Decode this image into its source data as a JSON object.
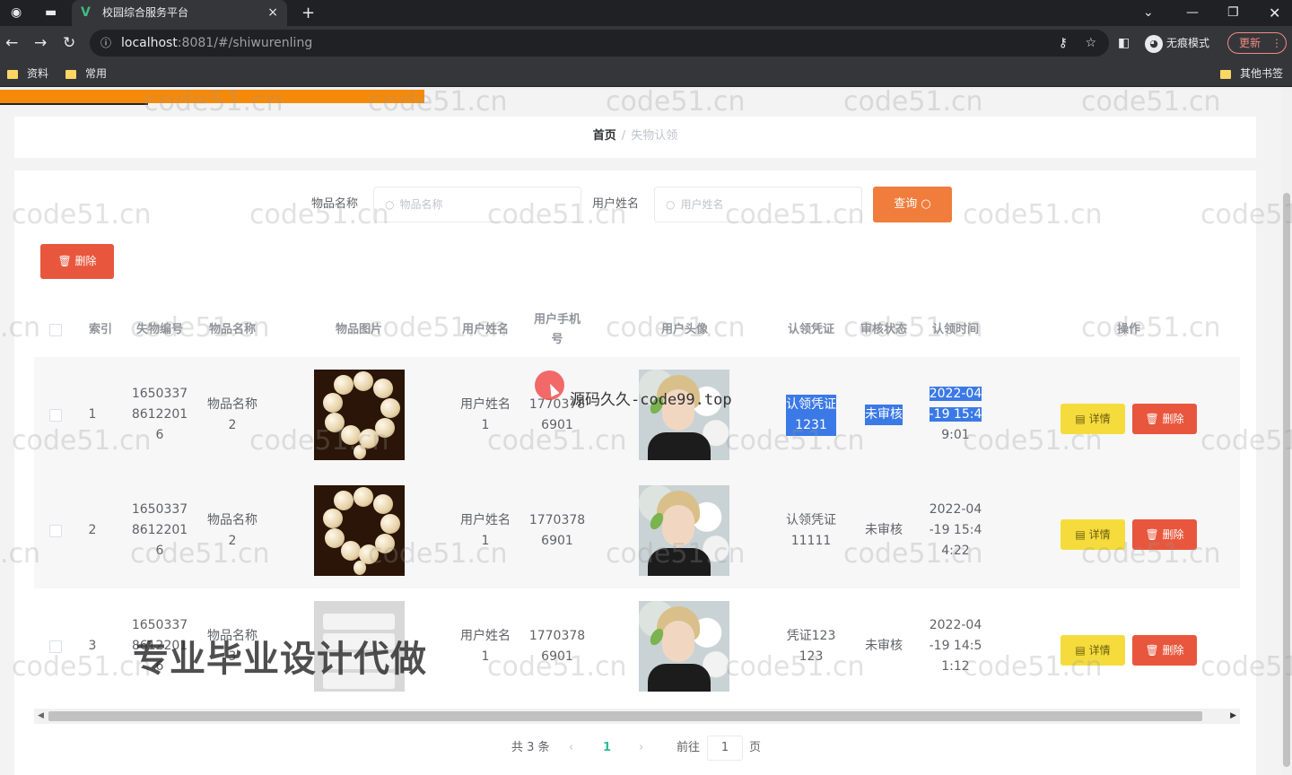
{
  "browser": {
    "tab_title": "校园综合服务平台",
    "tab_close": "×",
    "new_tab": "+",
    "url_host": "localhost",
    "url_path": ":8081/#/shiwurenling",
    "incognito_label": "无痕模式",
    "update_label": "更新",
    "bookmarks": [
      "资料",
      "常用"
    ],
    "other_bookmarks": "其他书签"
  },
  "breadcrumb": {
    "home": "首页",
    "separator": "/",
    "current": "失物认领"
  },
  "search": {
    "item_name_label": "物品名称",
    "item_name_placeholder": "物品名称",
    "user_name_label": "用户姓名",
    "user_name_placeholder": "用户姓名",
    "query_label": "查询"
  },
  "toolbar": {
    "delete_label": "删除"
  },
  "table": {
    "headers": [
      "索引",
      "失物编号",
      "物品名称",
      "物品图片",
      "用户姓名",
      "用户手机号",
      "用户头像",
      "认领凭证",
      "审核状态",
      "认领时间",
      "操作"
    ],
    "rows": [
      {
        "index": "1",
        "lost_no": "16503378612201\n6",
        "item_name": "物品名称\n2",
        "image": "beads",
        "user_name": "用户姓名\n1",
        "phone": "1770378\n6901",
        "voucher": "认领凭证\n1231",
        "status": "未审核",
        "time": "2022-04\n-19 15:4\n9:01"
      },
      {
        "index": "2",
        "lost_no": "16503378612201\n6",
        "item_name": "物品名称\n2",
        "image": "beads",
        "user_name": "用户姓名\n1",
        "phone": "1770378\n6901",
        "voucher": "认领凭证\n11111",
        "status": "未审核",
        "time": "2022-04\n-19 15:4\n4:22"
      },
      {
        "index": "3",
        "lost_no": "16503378612201\n6",
        "item_name": "物品名称\n3",
        "image": "towel",
        "user_name": "用户姓名\n1",
        "phone": "1770378\n6901",
        "voucher": "凭证123\n123",
        "status": "未审核",
        "time": "2022-04\n-19 14:5\n1:12"
      }
    ],
    "detail_label": "详情",
    "delete_label": "删除"
  },
  "pagination": {
    "total": "共 3 条",
    "current_page": "1",
    "goto_prefix": "前往",
    "goto_value": "1",
    "goto_suffix": "页"
  },
  "overlays": {
    "watermark": "code51.cn",
    "watermark_short": ".cn",
    "source_text": "源码久久-code99.top",
    "promo_text": "专业毕业设计代做"
  },
  "colors": {
    "accent": "#f07d3c",
    "danger": "#e8573d",
    "warning": "#f5dc3c",
    "progress": "#f58a0a",
    "page_active": "#2dbd96",
    "selection": "#3b79e6"
  }
}
